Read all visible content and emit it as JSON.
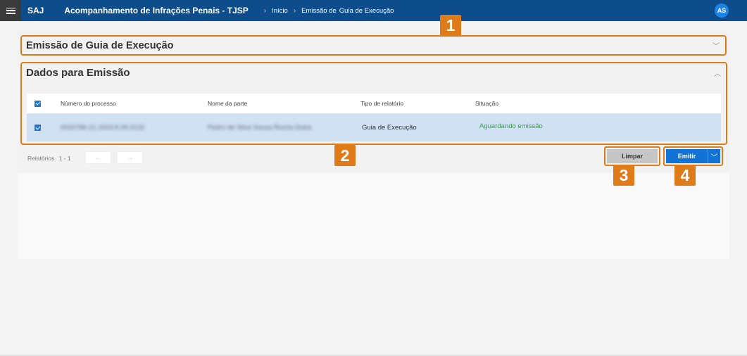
{
  "topbar": {
    "brand": "SAJ",
    "title": "Acompanhamento de Infrações Penais - TJSP",
    "breadcrumbs": [
      "Início",
      "Emissão de",
      "Guia de Execução"
    ],
    "avatar": "AS"
  },
  "panel_emissao": {
    "title": "Emissão de Guia de Execução"
  },
  "panel_dados": {
    "title": "Dados para Emissão",
    "columns": [
      "Número do processo",
      "Nome da parte",
      "Tipo de relatório",
      "Situação"
    ],
    "rows": [
      {
        "numero": "0000786-21.2003.8.26.0132",
        "nome": "Pedro de Silva Souza Rocha Dutra",
        "tipo": "Guia de Execução",
        "situacao": "Aguardando emissão"
      }
    ]
  },
  "footer": {
    "relatorios_label": "Relatórios",
    "relatorios_count": "1 - 1",
    "prev": "←",
    "next": "→",
    "limpar": "Limpar",
    "emitir": "Emitir"
  },
  "callouts": [
    "1",
    "2",
    "3",
    "4"
  ],
  "colors": {
    "topbar": "#0d4d8c",
    "accent": "#e07b1a",
    "primary": "#1272d6",
    "success": "#2eaa3c"
  }
}
